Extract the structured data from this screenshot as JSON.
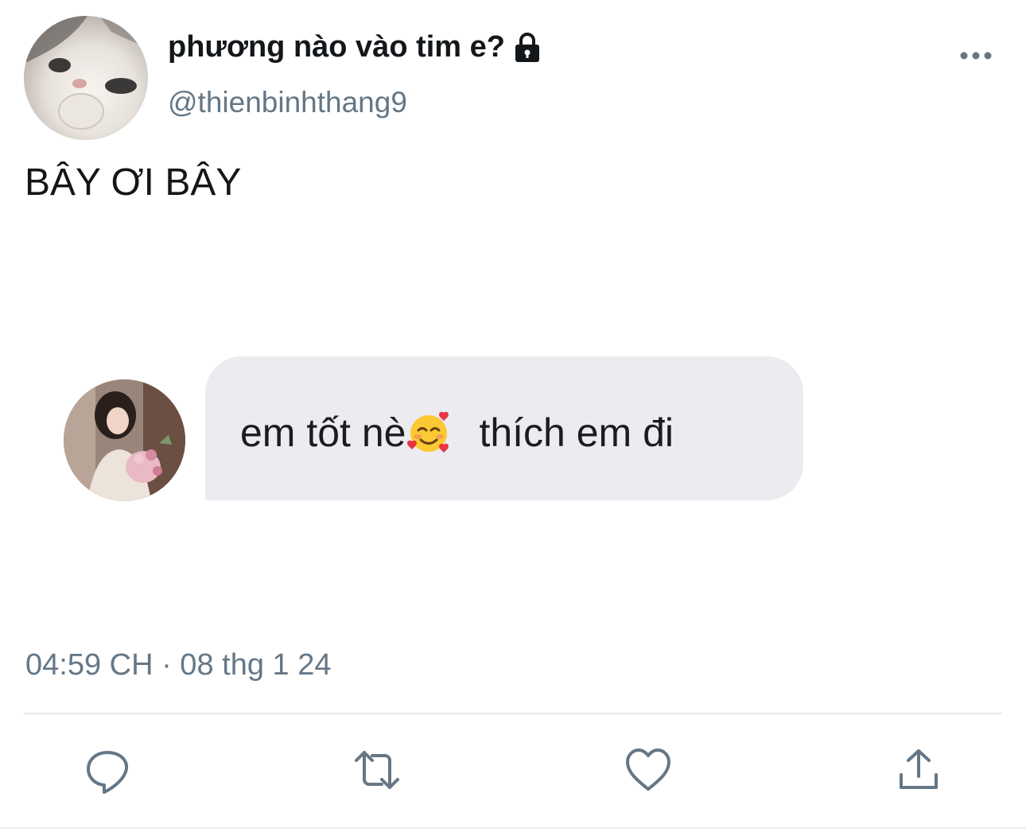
{
  "tweet": {
    "display_name": "phương nào vào tim e?",
    "handle": "@thienbinhthang9",
    "text": "BÂY ƠI BÂY",
    "timestamp": "04:59 CH · 08 thg 1 24"
  },
  "attached_message": {
    "text_part1": "em tốt nè",
    "emoji": "smiling-face-with-hearts",
    "text_part2": "thích em đi"
  },
  "icons": {
    "lock": "lock-icon",
    "more": "more-icon",
    "reply": "reply-icon",
    "retweet": "retweet-icon",
    "like": "heart-icon",
    "share": "share-icon"
  },
  "colors": {
    "secondary_text": "#657786",
    "bubble_bg": "#ebebf0",
    "divider": "#e1e8ed"
  }
}
